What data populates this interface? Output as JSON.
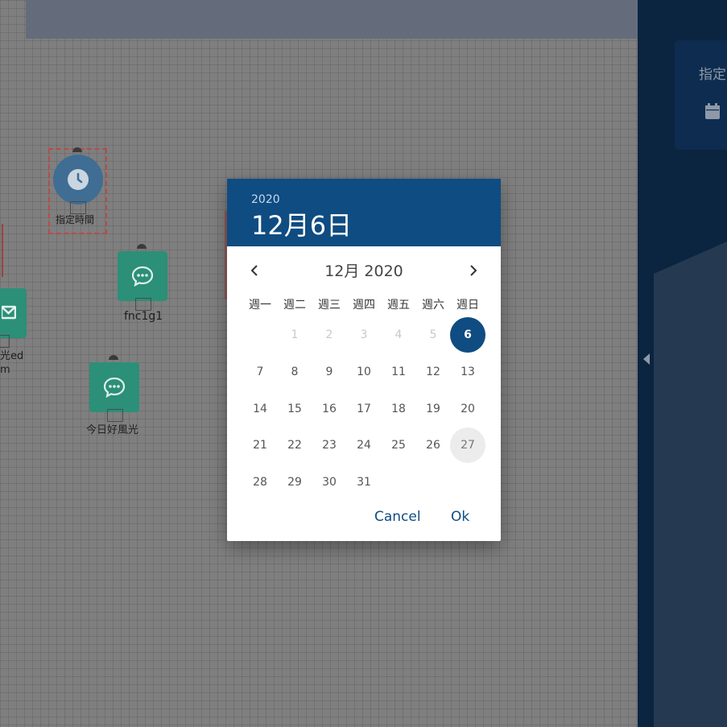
{
  "canvas": {
    "nodes": [
      {
        "id": "time",
        "label": "指定時間",
        "icon": "clock-icon"
      },
      {
        "id": "fnc",
        "label": "fnc1g1",
        "icon": "chat-icon"
      },
      {
        "id": "today",
        "label": "今日好風光",
        "icon": "chat-icon"
      },
      {
        "id": "partial",
        "label_line1": "光ed",
        "label_line2": "m",
        "icon": "mail-icon"
      }
    ]
  },
  "side_panel": {
    "title": "指定",
    "icon": "calendar-icon"
  },
  "date_picker": {
    "header_year": "2020",
    "header_date": "12月6日",
    "month_label": "12月 2020",
    "weekdays": [
      "週一",
      "週二",
      "週三",
      "週四",
      "週五",
      "週六",
      "週日"
    ],
    "days": [
      "1",
      "2",
      "3",
      "4",
      "5",
      "6",
      "7",
      "8",
      "9",
      "10",
      "11",
      "12",
      "13",
      "14",
      "15",
      "16",
      "17",
      "18",
      "19",
      "20",
      "21",
      "22",
      "23",
      "24",
      "25",
      "26",
      "27",
      "28",
      "29",
      "30",
      "31"
    ],
    "selected_day": "6",
    "hovered_day": "27",
    "cancel_label": "Cancel",
    "ok_label": "Ok"
  },
  "colors": {
    "primary": "#0f4c81",
    "node_green": "#2c8f78",
    "selection_red": "#b84a4a"
  }
}
